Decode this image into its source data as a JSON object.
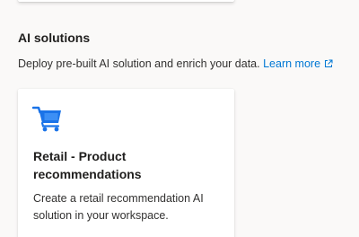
{
  "section": {
    "title": "AI solutions",
    "description": "Deploy pre-built AI solution and enrich your data.",
    "learn_more_label": "Learn more",
    "learn_more_icon": "external-link-icon"
  },
  "solutions": [
    {
      "icon": "shopping-cart-icon",
      "title": "Retail - Product recommendations",
      "description": "Create a retail recommendation AI solution in your workspace."
    }
  ],
  "colors": {
    "link": "#0078d4",
    "icon": "#1a73e8",
    "background": "#faf9f8",
    "card": "#ffffff"
  }
}
